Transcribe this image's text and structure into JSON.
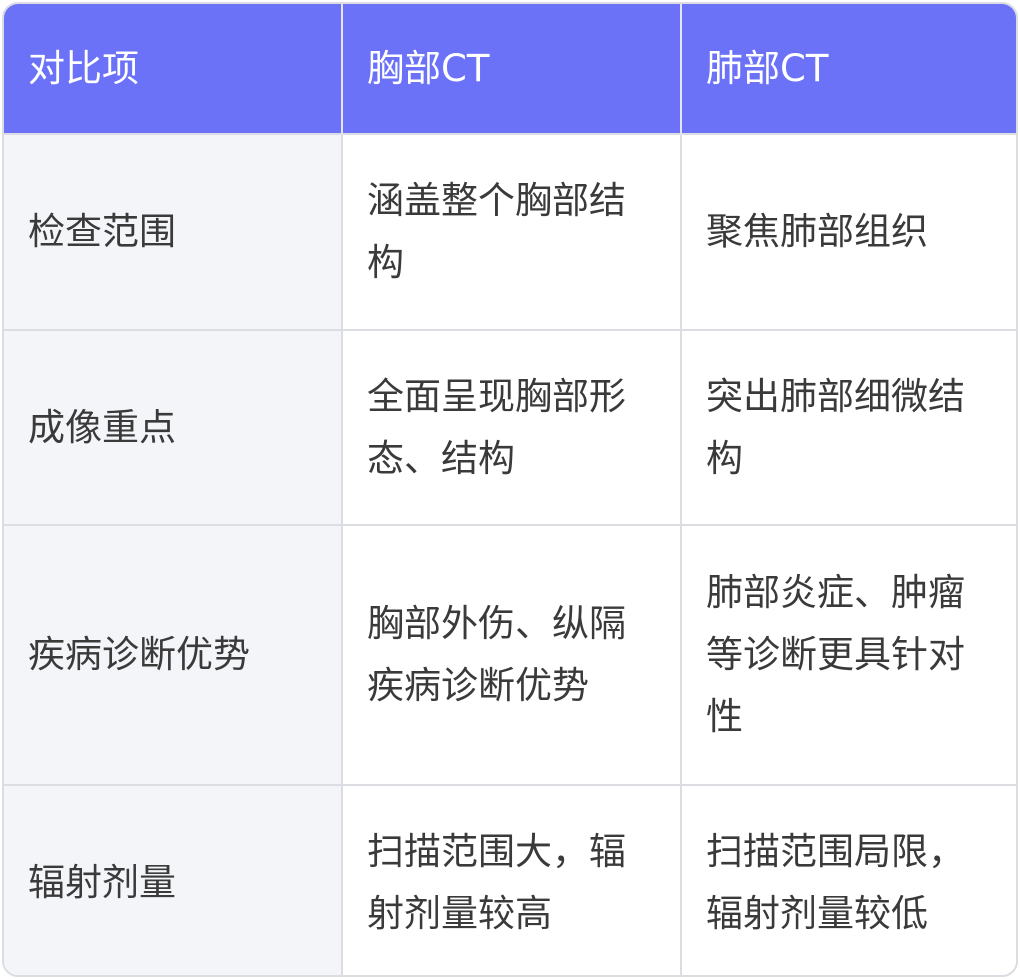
{
  "header": {
    "col1": "对比项",
    "col2": "胸部CT",
    "col3": "肺部CT"
  },
  "rows": [
    {
      "item": "检查范围",
      "chest_ct": "涵盖整个胸部结构",
      "lung_ct": "聚焦肺部组织"
    },
    {
      "item": "成像重点",
      "chest_ct": "全面呈现胸部形态、结构",
      "lung_ct": "突出肺部细微结构"
    },
    {
      "item": "疾病诊断优势",
      "chest_ct": "胸部外伤、纵隔疾病诊断优势",
      "lung_ct": "肺部炎症、肿瘤等诊断更具针对性"
    },
    {
      "item": "辐射剂量",
      "chest_ct": "扫描范围大，辐射剂量较高",
      "lung_ct": "扫描范围局限，辐射剂量较低"
    }
  ],
  "colors": {
    "header_bg": "#6b72f8",
    "header_text": "#ffffff",
    "first_col_bg": "#f4f5f9",
    "border": "#dcdde3",
    "body_text": "#3a3a3a"
  }
}
